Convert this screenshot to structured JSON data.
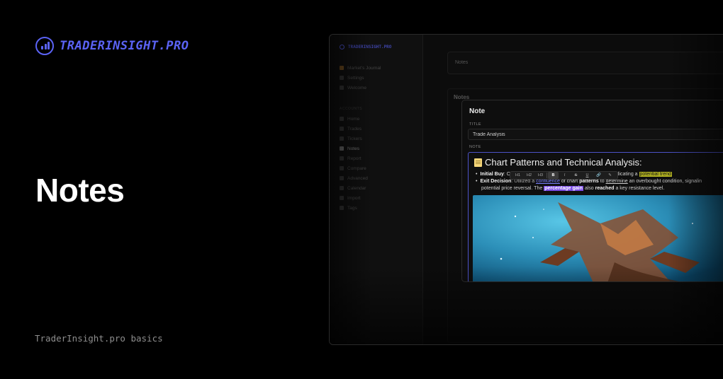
{
  "brand": {
    "name": "TRADERINSIGHT.PRO",
    "accent": "#5b63f5"
  },
  "hero": {
    "title": "Notes",
    "footer": "TraderInsight.pro basics"
  },
  "app": {
    "sidebar": {
      "brand": "TRADERINSIGHT.PRO",
      "top_items": [
        "Market's Journal",
        "Settings",
        "Welcome"
      ],
      "section": "ACCOUNTS",
      "items": [
        "Home",
        "Trades",
        "Tickers",
        "Notes",
        "Report",
        "Compare",
        "Advanced",
        "Calendar",
        "Import",
        "Tags"
      ],
      "active": "Notes"
    },
    "topbar": {
      "label": "Notes"
    },
    "heading": "Notes",
    "modal": {
      "title": "Note",
      "title_label": "TITLE",
      "title_value": "Trade Analysis",
      "note_label": "NOTE",
      "editor": {
        "heading": "Chart Patterns and Technical Analysis:",
        "bullet1_label": "Initial Buy",
        "bullet1_prefix": ": Ob",
        "bullet1_mid": "indicating a",
        "bullet1_highlight": "potential trend",
        "bullet2_label": "Exit Decision",
        "bullet2_a": ": Utilized a",
        "bullet2_link": "confluence",
        "bullet2_b": "of chart",
        "bullet2_bold": "patterns",
        "bullet2_c": "to",
        "bullet2_underline": "determine",
        "bullet2_d": "an overbought condition, signalin",
        "bullet2_line2a": "potential price reversal. The",
        "bullet2_highlight": "percentage gain",
        "bullet2_line2b": "also",
        "bullet2_bold2": "reached",
        "bullet2_line2c": "a key resistance level."
      },
      "toolbar": [
        "H1",
        "H2",
        "H3",
        "B",
        "I",
        "S",
        "U",
        "🔗",
        "✎"
      ]
    }
  }
}
